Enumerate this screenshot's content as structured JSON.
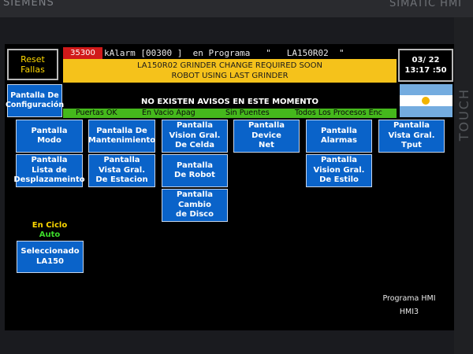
{
  "bezel": {
    "brand": "SIEMENS",
    "model": "SIMATIC HMI",
    "side_label": "TOUCH"
  },
  "reset_button": {
    "label": "Reset\nFallas"
  },
  "config_button": {
    "label": "Pantalla De\nConfiguración"
  },
  "alarm": {
    "code": "35300",
    "line": "kAlarm [00300 ]  en Programa   \"   LA150R02  \"",
    "messages": [
      "LA150R02 GRINDER CHANGE REQUIRED SOON",
      "ROBOT USING LAST GRINDER"
    ]
  },
  "clock": {
    "date": "03/ 22",
    "time": "13:17 :50"
  },
  "flag_colors": {
    "blue": "#74acdf",
    "white": "#ffffff",
    "sun": "#f2b400"
  },
  "notice": "NO EXISTEN AVISOS EN ESTE MOMENTO",
  "status_items": [
    "Puertas OK",
    "En Vacio Apag",
    "Sin Puentes",
    "Todos Los Procesos Enc"
  ],
  "screen_buttons": {
    "modo": "Pantalla\nModo",
    "mantenimiento": "Pantalla De\nMantenimiento",
    "vision_celda": "Pantalla\nVision Gral.\nDe Celda",
    "device_net": "Pantalla\nDevice\nNet",
    "alarmas": "Pantalla\nAlarmas",
    "vista_tput": "Pantalla\nVista Gral.\nTput",
    "lista_desplazamiento": "Pantalla\nLista de\nDesplazameinto",
    "vista_estacion": "Pantalla\nVista Gral.\nDe Estacion",
    "robot": "Pantalla\nDe Robot",
    "vision_estilo": "Pantalla\nVision Gral.\nDe Estilo",
    "cambio_disco": "Pantalla\nCambio\nde Disco"
  },
  "cycle_status": {
    "line1": "En Ciclo",
    "line2": "Auto"
  },
  "selected_button": {
    "label": "Seleccionado\nLA150"
  },
  "hmi_info": {
    "program": "Programa HMI",
    "name": "HMI3"
  },
  "colors": {
    "button_blue": "#0a63c9",
    "alarm_red": "#d11a1a",
    "banner_yellow": "#f5c21b",
    "status_green": "#45b81c"
  }
}
